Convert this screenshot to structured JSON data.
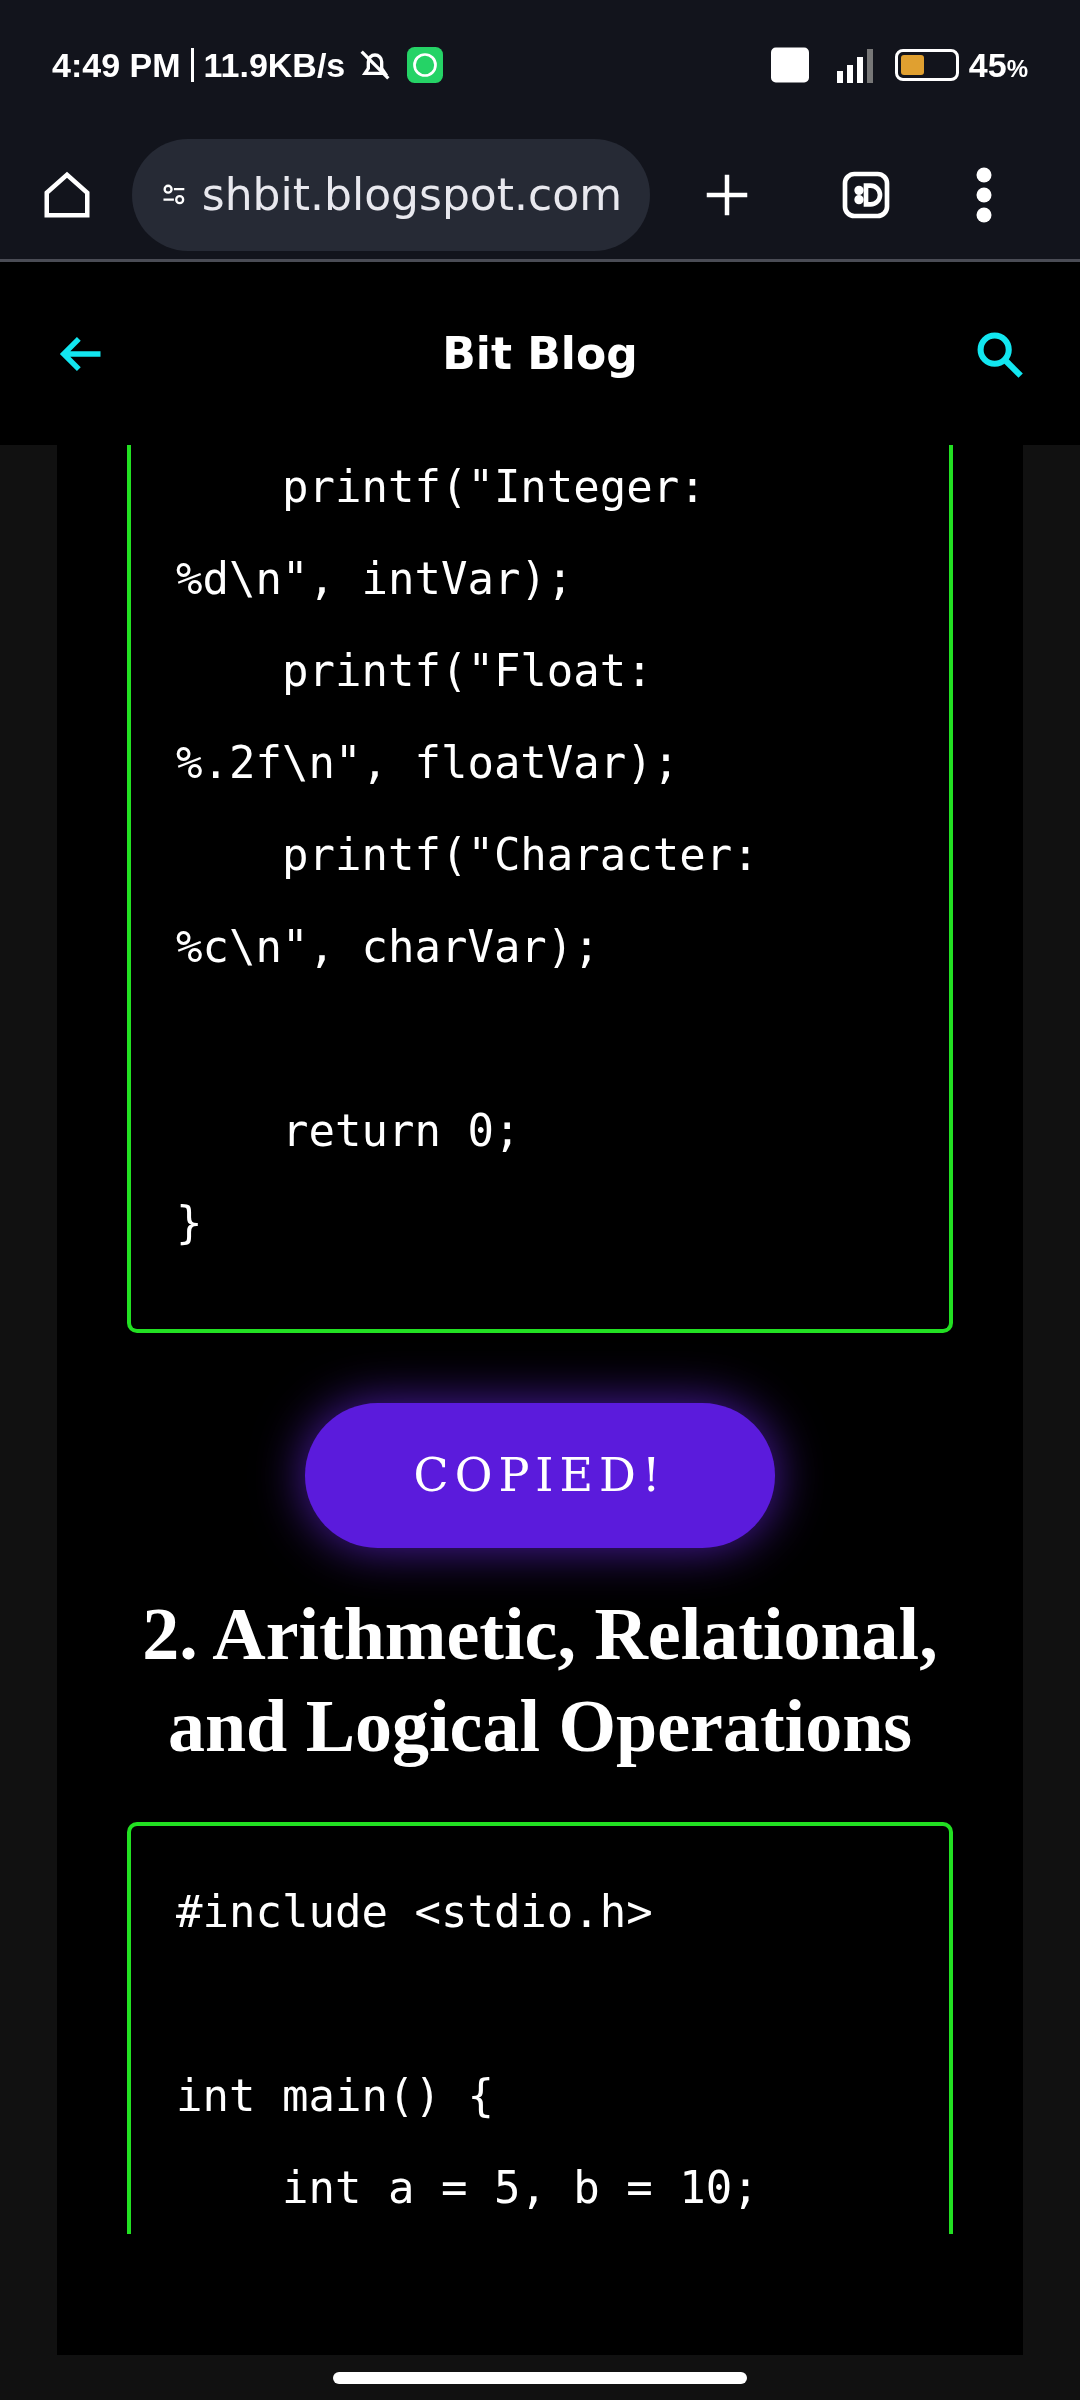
{
  "status_bar": {
    "time": "4:49 PM",
    "speed": "11.9KB/s",
    "battery": "45",
    "battery_unit": "%"
  },
  "browser": {
    "url": "shbit.blogspot.com"
  },
  "app_bar": {
    "title": "Bit Blog"
  },
  "code_blocks": [
    {
      "lines": [
        {
          "kind": "code",
          "text": "    printf(\"Integer:"
        },
        {
          "kind": "code",
          "text": "%d\\n\", intVar);"
        },
        {
          "kind": "code",
          "text": "    printf(\"Float:"
        },
        {
          "kind": "code",
          "text": "%.2f\\n\", floatVar);"
        },
        {
          "kind": "code",
          "text": "    printf(\"Character:"
        },
        {
          "kind": "code",
          "text": "%c\\n\", charVar);"
        },
        {
          "kind": "blank"
        },
        {
          "kind": "code",
          "text": "    return 0;"
        },
        {
          "kind": "code",
          "text": "}"
        }
      ]
    },
    {
      "lines": [
        {
          "kind": "code",
          "text": "#include <stdio.h>"
        },
        {
          "kind": "blank"
        },
        {
          "kind": "code",
          "text": "int main() {"
        },
        {
          "kind": "code",
          "text": "    int a = 5, b = 10;"
        }
      ]
    }
  ],
  "copy_button": {
    "label": "COPIED!"
  },
  "heading": "2. Arithmetic, Relational, and Logical Operations"
}
